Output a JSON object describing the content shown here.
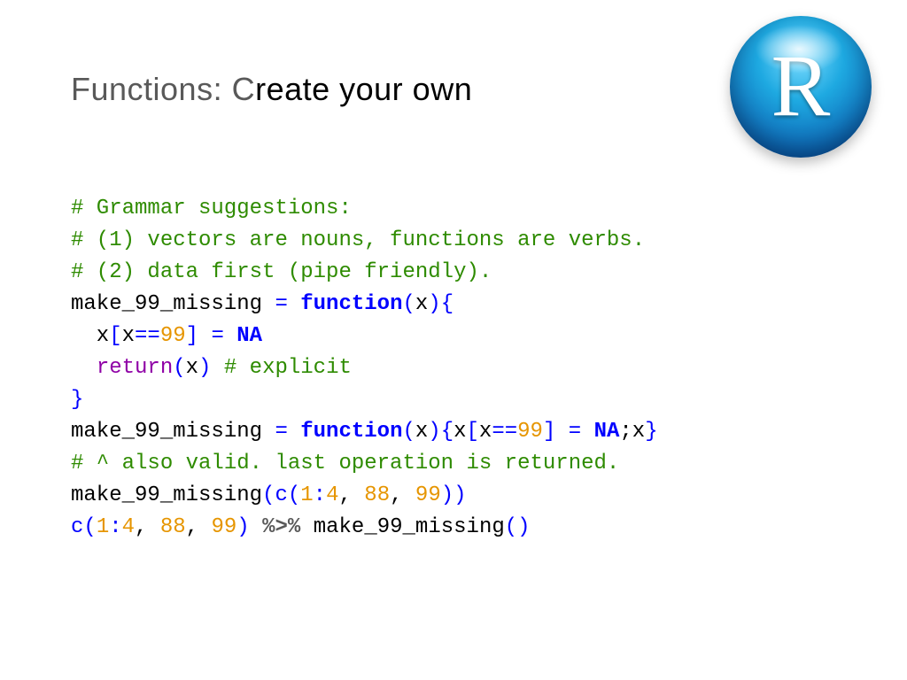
{
  "title": {
    "prefix": "Functions: C",
    "emph": "reate your own"
  },
  "logo": {
    "letter": "R"
  },
  "code": {
    "l1": "# Grammar suggestions:",
    "l2": "# (1) vectors are nouns, functions are verbs.",
    "l3": "# (2) data first (pipe friendly).",
    "l4a": "make_99_missing ",
    "l4b": "=",
    "l4c": " ",
    "l4d": "function",
    "l4e": "(",
    "l4f": "x",
    "l4g": ")",
    "l4h": "{",
    "l5a": "  x",
    "l5b": "[",
    "l5c": "x",
    "l5d": "==",
    "l5e": "99",
    "l5f": "]",
    "l5g": " ",
    "l5h": "=",
    "l5i": " ",
    "l5j": "NA",
    "l6a": "  ",
    "l6b": "return",
    "l6c": "(",
    "l6d": "x",
    "l6e": ")",
    "l6f": " ",
    "l6g": "# explicit",
    "l7a": "}",
    "l8a": "make_99_missing ",
    "l8b": "=",
    "l8c": " ",
    "l8d": "function",
    "l8e": "(",
    "l8f": "x",
    "l8g": ")",
    "l8h": "{",
    "l8i": "x",
    "l8j": "[",
    "l8k": "x",
    "l8l": "==",
    "l8m": "99",
    "l8n": "]",
    "l8o": " ",
    "l8p": "=",
    "l8q": " ",
    "l8r": "NA",
    "l8s": ";x",
    "l8t": "}",
    "l9": "# ^ also valid. last operation is returned.",
    "l10a": "make_99_missing",
    "l10b": "(",
    "l10c": "c",
    "l10d": "(",
    "l10e": "1",
    "l10f": ":",
    "l10g": "4",
    "l10h": ", ",
    "l10i": "88",
    "l10j": ", ",
    "l10k": "99",
    "l10l": ")",
    "l10m": ")",
    "l11a": "c",
    "l11b": "(",
    "l11c": "1",
    "l11d": ":",
    "l11e": "4",
    "l11f": ", ",
    "l11g": "88",
    "l11h": ", ",
    "l11i": "99",
    "l11j": ")",
    "l11k": " ",
    "l11l": "%>%",
    "l11m": " make_99_missing",
    "l11n": "(",
    "l11o": ")"
  }
}
